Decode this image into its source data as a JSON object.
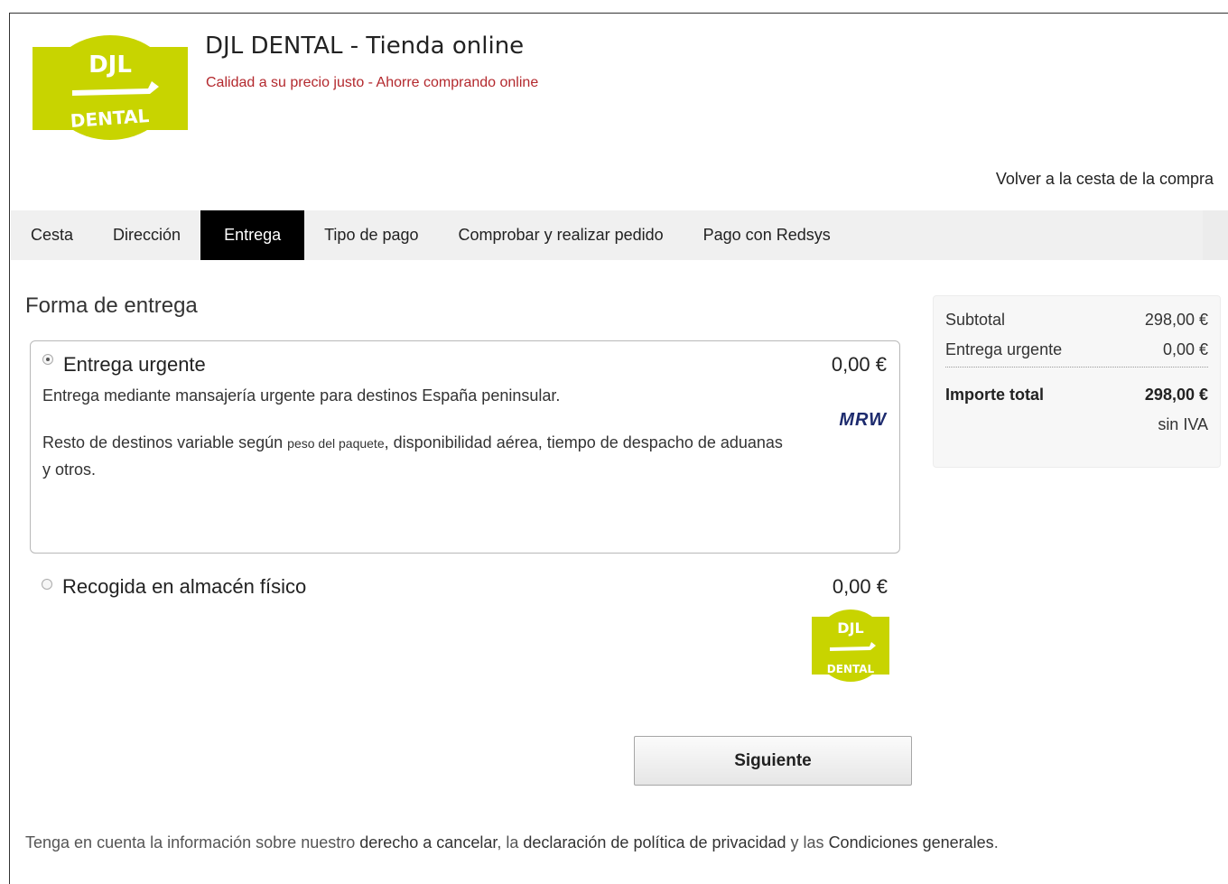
{
  "header": {
    "logo_text_top": "DJL",
    "logo_text_bottom": "DENTAL",
    "title": "DJL DENTAL - Tienda online",
    "subtitle": "Calidad a su precio justo - Ahorre comprando online",
    "back_link": "Volver a la cesta de la compra"
  },
  "tabs": [
    {
      "label": "Cesta",
      "active": false
    },
    {
      "label": "Dirección",
      "active": false
    },
    {
      "label": "Entrega",
      "active": true
    },
    {
      "label": "Tipo de pago",
      "active": false
    },
    {
      "label": "Comprobar y realizar pedido",
      "active": false
    },
    {
      "label": "Pago con Redsys",
      "active": false
    }
  ],
  "main": {
    "section_title": "Forma de entrega",
    "options": [
      {
        "name": "Entrega urgente",
        "price": "0,00 €",
        "selected": true,
        "desc1": "Entrega mediante mansajería urgente para destinos España peninsular.",
        "desc2_a": "Resto de destinos variable según ",
        "desc2_small": "peso del paquete",
        "desc2_b": ", disponibilidad aérea, tiempo de despacho de aduanas y otros.",
        "carrier_logo": "MRW"
      },
      {
        "name": "Recogida en almacén físico",
        "price": "0,00 €",
        "selected": false
      }
    ],
    "next_button": "Siguiente"
  },
  "summary": {
    "subtotal_label": "Subtotal",
    "subtotal_value": "298,00 €",
    "shipping_label": "Entrega urgente",
    "shipping_value": "0,00 €",
    "total_label": "Importe total",
    "total_value": "298,00 €",
    "tax_note": "sin IVA"
  },
  "footer": {
    "text_1": "Tenga en cuenta la información sobre nuestro ",
    "link_cancel": "derecho a cancelar",
    "text_2": ", la ",
    "link_privacy": "declaración de política de privacidad",
    "text_3": " y las ",
    "link_terms": "Condiciones generales",
    "text_4": "."
  },
  "colors": {
    "brand_green": "#c8d400",
    "subtitle_red": "#b3282d",
    "active_tab_bg": "#000000",
    "mrw_blue": "#1d2b6e"
  }
}
